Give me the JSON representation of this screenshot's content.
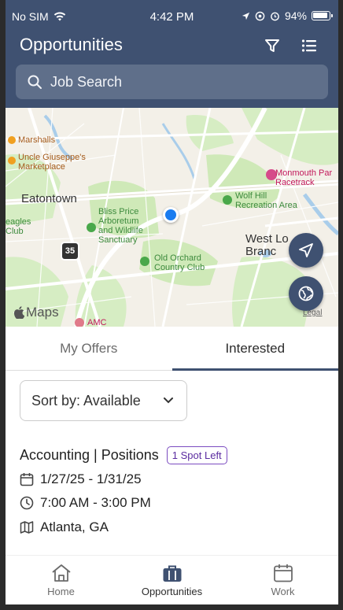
{
  "status_bar": {
    "carrier": "No SIM",
    "time": "4:42 PM",
    "battery": "94%"
  },
  "header": {
    "title": "Opportunities",
    "filter_icon": "filter-icon",
    "list_icon": "list-icon"
  },
  "search": {
    "placeholder": "Job Search"
  },
  "map": {
    "labels": {
      "marshalls": "Marshalls",
      "uncle_line1": "Uncle Giuseppe's",
      "uncle_line2": "Marketplace",
      "monmouth_line1": "Monmouth Par",
      "monmouth_line2": "Racetrack",
      "eatontown": "Eatontown",
      "wolf_line1": "Wolf Hill",
      "wolf_line2": "Recreation Area",
      "eagles_line1": "eagles",
      "eagles_line2": "Club",
      "bliss_line1": "Bliss Price",
      "bliss_line2": "Arboretum",
      "bliss_line3": "and Wildlife",
      "bliss_line4": "Sanctuary",
      "westlong_line1": "West Lo",
      "westlong_line2": "Branc",
      "route": "35",
      "orchard_line1": "Old Orchard",
      "orchard_line2": "Country Club",
      "amc": "AMC",
      "maps": "Maps",
      "legal": "Legal"
    },
    "accent_blue": "#1a7cf0"
  },
  "tabs": [
    {
      "label": "My Offers",
      "active": false
    },
    {
      "label": "Interested",
      "active": true
    }
  ],
  "sort": {
    "label": "Sort by: Available"
  },
  "job": {
    "title": "Accounting | Positions",
    "badge": "1 Spot Left",
    "dates": "1/27/25 - 1/31/25",
    "time": "7:00 AM - 3:00 PM",
    "location": "Atlanta, GA"
  },
  "bottom_nav": [
    {
      "label": "Home",
      "icon": "home-icon",
      "active": false
    },
    {
      "label": "Opportunities",
      "icon": "briefcase-icon",
      "active": true
    },
    {
      "label": "Work",
      "icon": "calendar-icon",
      "active": false
    }
  ],
  "colors": {
    "header": "#3f5171",
    "badge": "#7b4cc0"
  }
}
